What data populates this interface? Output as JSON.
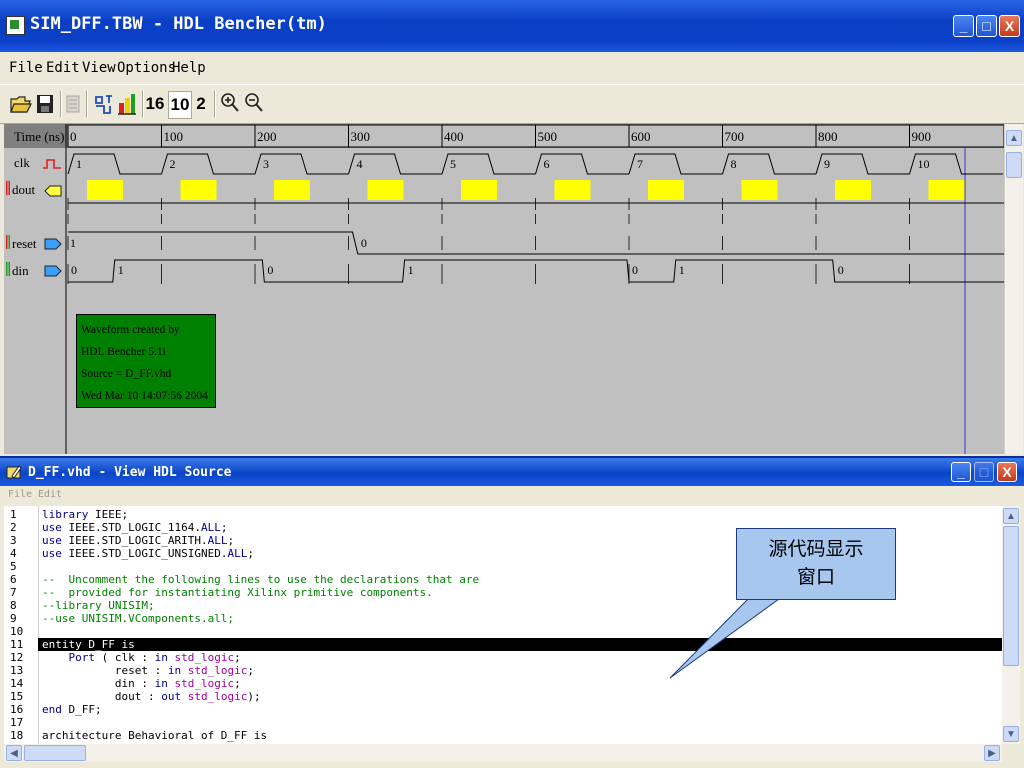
{
  "window": {
    "title": "SIM_DFF.TBW - HDL Bencher(tm)",
    "min_glyph": "_",
    "max_glyph": "□",
    "close_glyph": "X"
  },
  "menu": [
    "File",
    "Edit",
    "View",
    "Options",
    "Help"
  ],
  "toolbar": {
    "open_icon": "open-folder-icon",
    "save_icon": "save-icon",
    "radix_hex": "16",
    "radix_dec": "10",
    "radix_bin": "2",
    "zoom_in_icon": "zoom-in-icon",
    "zoom_out_icon": "zoom-out-icon"
  },
  "waveform": {
    "time_label": "Time (ns)",
    "time_ticks": [
      "0",
      "100",
      "200",
      "300",
      "400",
      "500",
      "600",
      "700",
      "800",
      "900"
    ],
    "signals": [
      {
        "name": "clk",
        "icon": "clock-icon"
      },
      {
        "name": "dout",
        "icon": "output-icon"
      },
      {
        "name": "reset",
        "icon": "input-icon"
      },
      {
        "name": "din",
        "icon": "input-icon"
      }
    ],
    "clk_labels": [
      "1",
      "2",
      "3",
      "4",
      "5",
      "6",
      "7",
      "8",
      "9",
      "10"
    ],
    "reset_values": [
      "1",
      "0"
    ],
    "din_values": [
      "0",
      "1",
      "0",
      "1",
      "0",
      "1",
      "0"
    ],
    "info_box": [
      "Waveform created by",
      "HDL Bencher 5.1i",
      "Source = D_FF.vhd",
      "Wed Mar 10 14:07:56 2004"
    ],
    "colors": {
      "background": "#c0c0c0",
      "dout_highlight": "#ffff00",
      "info_box": "#008000"
    }
  },
  "source_window": {
    "title": "D_FF.vhd - View HDL Source",
    "menu": [
      "File",
      "Edit"
    ],
    "lines": [
      {
        "n": "1",
        "t": "library IEEE;"
      },
      {
        "n": "2",
        "t": "use IEEE.STD_LOGIC_1164.ALL;"
      },
      {
        "n": "3",
        "t": "use IEEE.STD_LOGIC_ARITH.ALL;"
      },
      {
        "n": "4",
        "t": "use IEEE.STD_LOGIC_UNSIGNED.ALL;"
      },
      {
        "n": "5",
        "t": ""
      },
      {
        "n": "6",
        "t": "--  Uncomment the following lines to use the declarations that are"
      },
      {
        "n": "7",
        "t": "--  provided for instantiating Xilinx primitive components."
      },
      {
        "n": "8",
        "t": "--library UNISIM;"
      },
      {
        "n": "9",
        "t": "--use UNISIM.VComponents.all;"
      },
      {
        "n": "10",
        "t": ""
      },
      {
        "n": "11",
        "t": "entity D_FF is"
      },
      {
        "n": "12",
        "t": "    Port ( clk : in std_logic;"
      },
      {
        "n": "13",
        "t": "           reset : in std_logic;"
      },
      {
        "n": "14",
        "t": "           din : in std_logic;"
      },
      {
        "n": "15",
        "t": "           dout : out std_logic);"
      },
      {
        "n": "16",
        "t": "end D_FF;"
      },
      {
        "n": "17",
        "t": ""
      },
      {
        "n": "18",
        "t": "architecture Behavioral of D_FF is"
      }
    ]
  },
  "callout": {
    "line1": "源代码显示",
    "line2": "窗口"
  }
}
